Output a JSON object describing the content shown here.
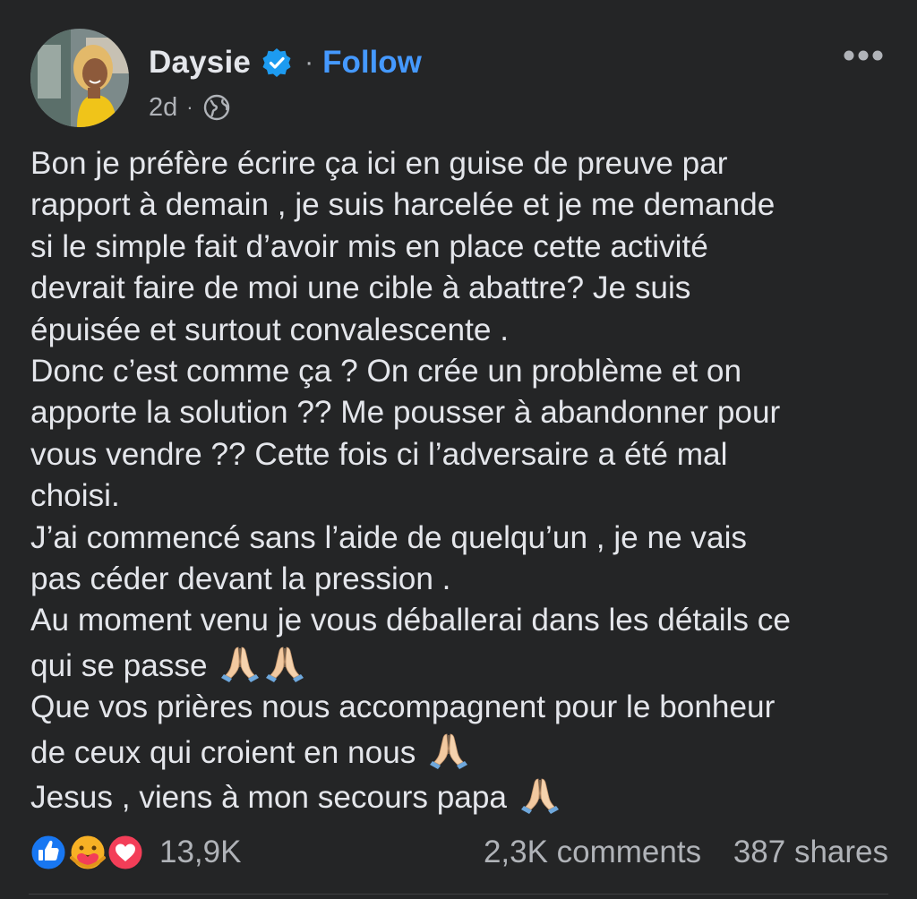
{
  "post": {
    "author": {
      "name": "Daysie",
      "verified": true,
      "avatar_icon": "profile-photo"
    },
    "follow_label": "Follow",
    "separator": "·",
    "time_ago": "2d",
    "audience_icon": "globe-icon",
    "more_icon": "more-horizontal-icon",
    "lines": [
      "Bon je préfère écrire ça ici en guise de preuve par",
      "rapport à demain , je suis harcelée et je me demande",
      "si le simple fait d’avoir mis en place cette activité",
      "devrait faire de moi une cible à abattre? Je suis",
      "épuisée et surtout convalescente .",
      "Donc c’est comme ça ? On crée un problème et on",
      "apporte la solution ?? Me pousser à abandonner pour",
      "vous vendre ?? Cette fois ci l’adversaire a été mal",
      "choisi.",
      "J’ai commencé sans l’aide de quelqu’un , je ne vais",
      "pas céder devant la pression .",
      "Au moment venu je vous déballerai dans les détails ce",
      "qui se passe",
      "Que vos prières nous accompagnent pour le bonheur",
      "de ceux qui croient en nous",
      "Jesus , viens à mon secours papa"
    ],
    "emoji_icon": "folded-hands-icon"
  },
  "stats": {
    "reaction_icons": [
      "like-icon",
      "care-icon",
      "love-icon"
    ],
    "reaction_count": "13,9K",
    "comments": "2,3K comments",
    "shares": "387 shares"
  },
  "colors": {
    "background": "#242526",
    "text_primary": "#e4e6eb",
    "text_secondary": "#b0b3b8",
    "link_blue": "#4599ff",
    "like_blue": "#1877f2",
    "love_red": "#f33e58",
    "care_yellow": "#f7b125"
  }
}
